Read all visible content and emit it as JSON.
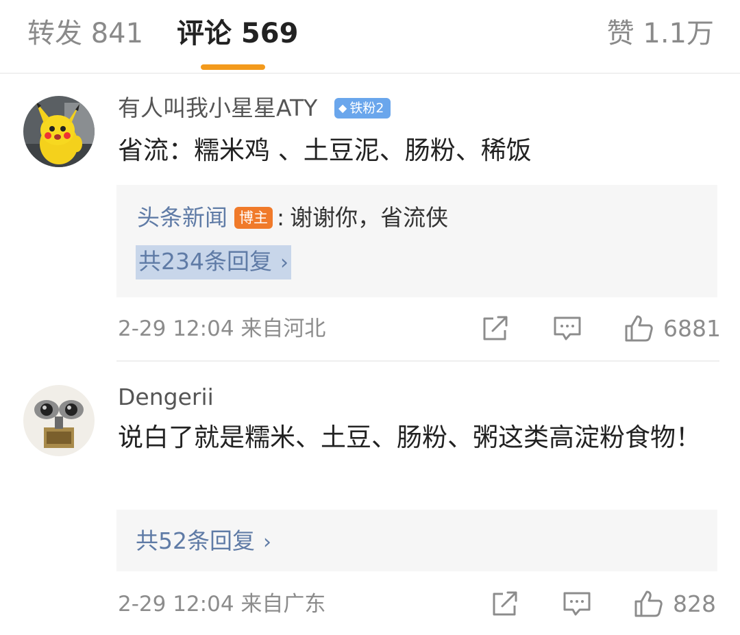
{
  "tabs": {
    "repost_label": "转发 841",
    "comments_label": "评论 569",
    "likes_label": "赞 1.1万",
    "active_color": "#f39a1c"
  },
  "comments": [
    {
      "username": "有人叫我小星星ATY",
      "fan_badge": "铁粉2",
      "text": "省流：糯米鸡 、土豆泥、肠粉、稀饭",
      "reply_preview": {
        "author": "头条新闻",
        "badge": "博主",
        "text": "谢谢你，省流侠"
      },
      "more_replies": "共234条回复",
      "meta": "2-29 12:04  来自河北",
      "likes": "6881",
      "avatar": "pikachu-avatar"
    },
    {
      "username": "Dengerii",
      "text": "说白了就是糯米、土豆、肠粉、粥这类高淀粉食物！",
      "more_replies": "共52条回复",
      "meta": "2-29 12:04  来自广东",
      "likes": "828",
      "avatar": "robot-avatar"
    }
  ],
  "icons": {
    "share": "share-icon",
    "comment": "comment-icon",
    "like": "thumbs-up-icon",
    "chevron": "chevron-right-icon"
  }
}
